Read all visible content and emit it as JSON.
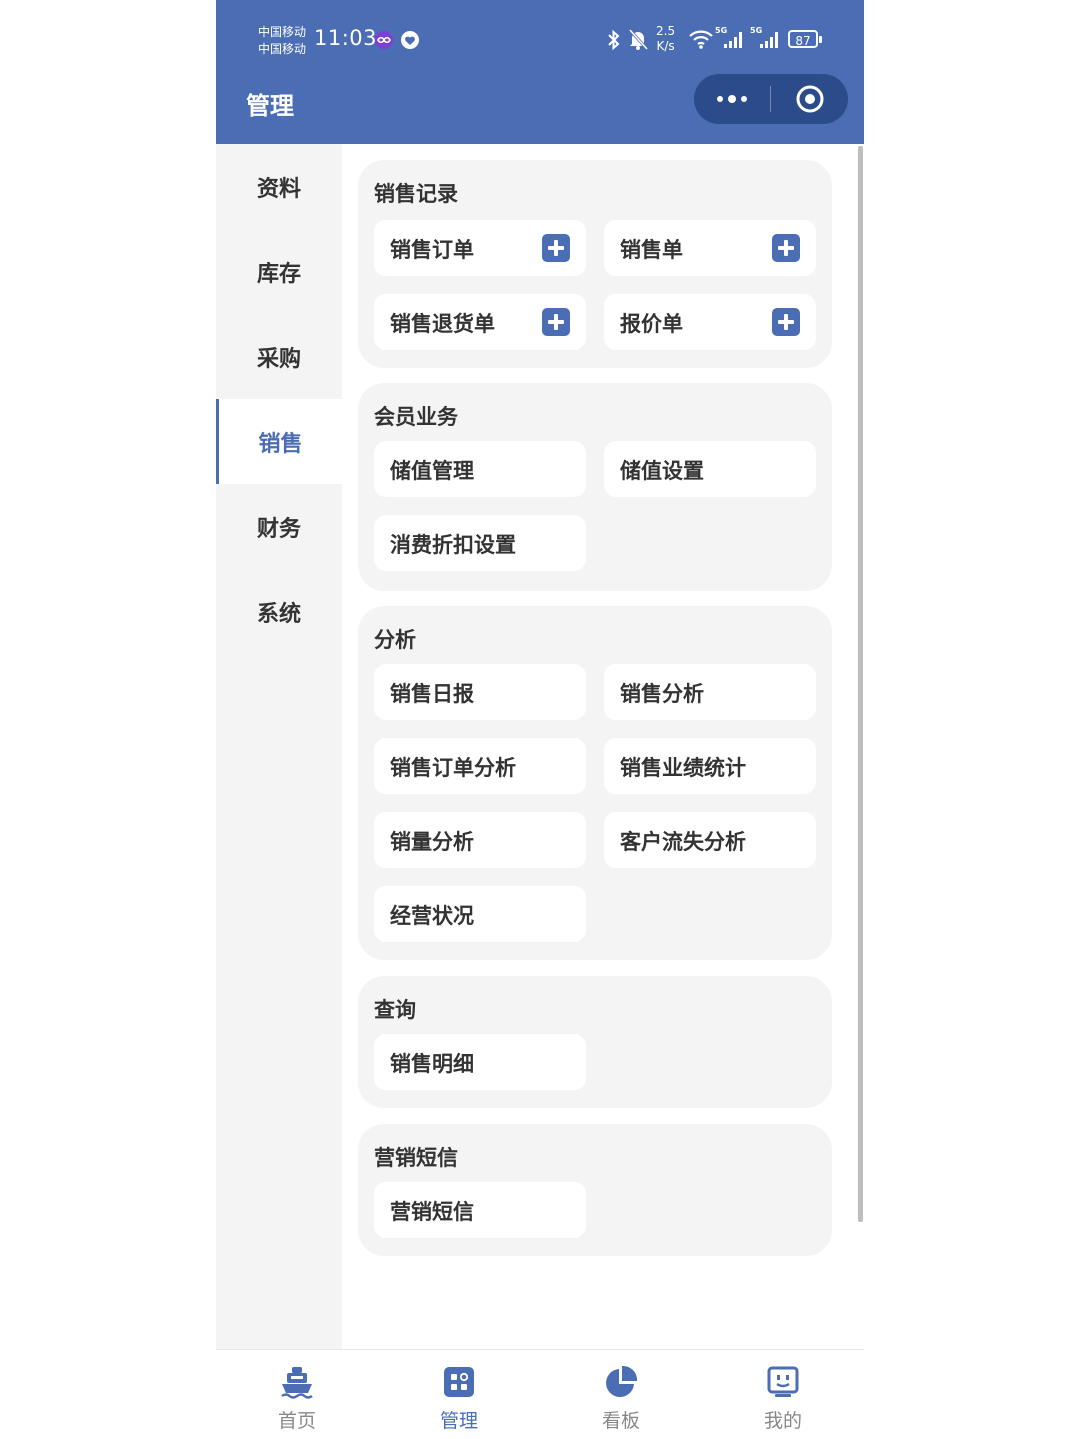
{
  "status_bar": {
    "carrier_1": "中国移动",
    "carrier_2": "中国移动",
    "time": "11:03",
    "net_speed_value": "2.5",
    "net_speed_unit": "K/s",
    "signal_1": "5G",
    "signal_2": "5G",
    "battery": "87"
  },
  "header": {
    "title": "管理",
    "more_icon": "more-dots-icon",
    "close_icon": "target-circle-icon"
  },
  "sidebar": {
    "items": [
      {
        "label": "资料"
      },
      {
        "label": "库存"
      },
      {
        "label": "采购"
      },
      {
        "label": "销售"
      },
      {
        "label": "财务"
      },
      {
        "label": "系统"
      }
    ],
    "active": "销售"
  },
  "sections": [
    {
      "title": "销售记录",
      "items": [
        {
          "label": "销售订单",
          "icon": "plus-icon"
        },
        {
          "label": "销售单",
          "icon": "plus-icon"
        },
        {
          "label": "销售退货单",
          "icon": "plus-icon"
        },
        {
          "label": "报价单",
          "icon": "plus-icon"
        }
      ]
    },
    {
      "title": "会员业务",
      "items": [
        {
          "label": "储值管理"
        },
        {
          "label": "储值设置"
        },
        {
          "label": "消费折扣设置"
        }
      ]
    },
    {
      "title": "分析",
      "items": [
        {
          "label": "销售日报"
        },
        {
          "label": "销售分析"
        },
        {
          "label": "销售订单分析"
        },
        {
          "label": "销售业绩统计"
        },
        {
          "label": "销量分析"
        },
        {
          "label": "客户流失分析"
        },
        {
          "label": "经营状况"
        }
      ]
    },
    {
      "title": "查询",
      "items": [
        {
          "label": "销售明细"
        }
      ]
    },
    {
      "title": "营销短信",
      "items": [
        {
          "label": "营销短信"
        }
      ]
    }
  ],
  "tabbar": {
    "items": [
      {
        "label": "首页",
        "icon": "ship-icon"
      },
      {
        "label": "管理",
        "icon": "grid-icon"
      },
      {
        "label": "看板",
        "icon": "pie-chart-icon"
      },
      {
        "label": "我的",
        "icon": "face-box-icon"
      }
    ],
    "active": "管理"
  },
  "colors": {
    "accent": "#4a6db3",
    "header_bg": "#4a6db3",
    "capsule_bg": "#2c4b8a",
    "card_bg": "#f4f4f4"
  }
}
